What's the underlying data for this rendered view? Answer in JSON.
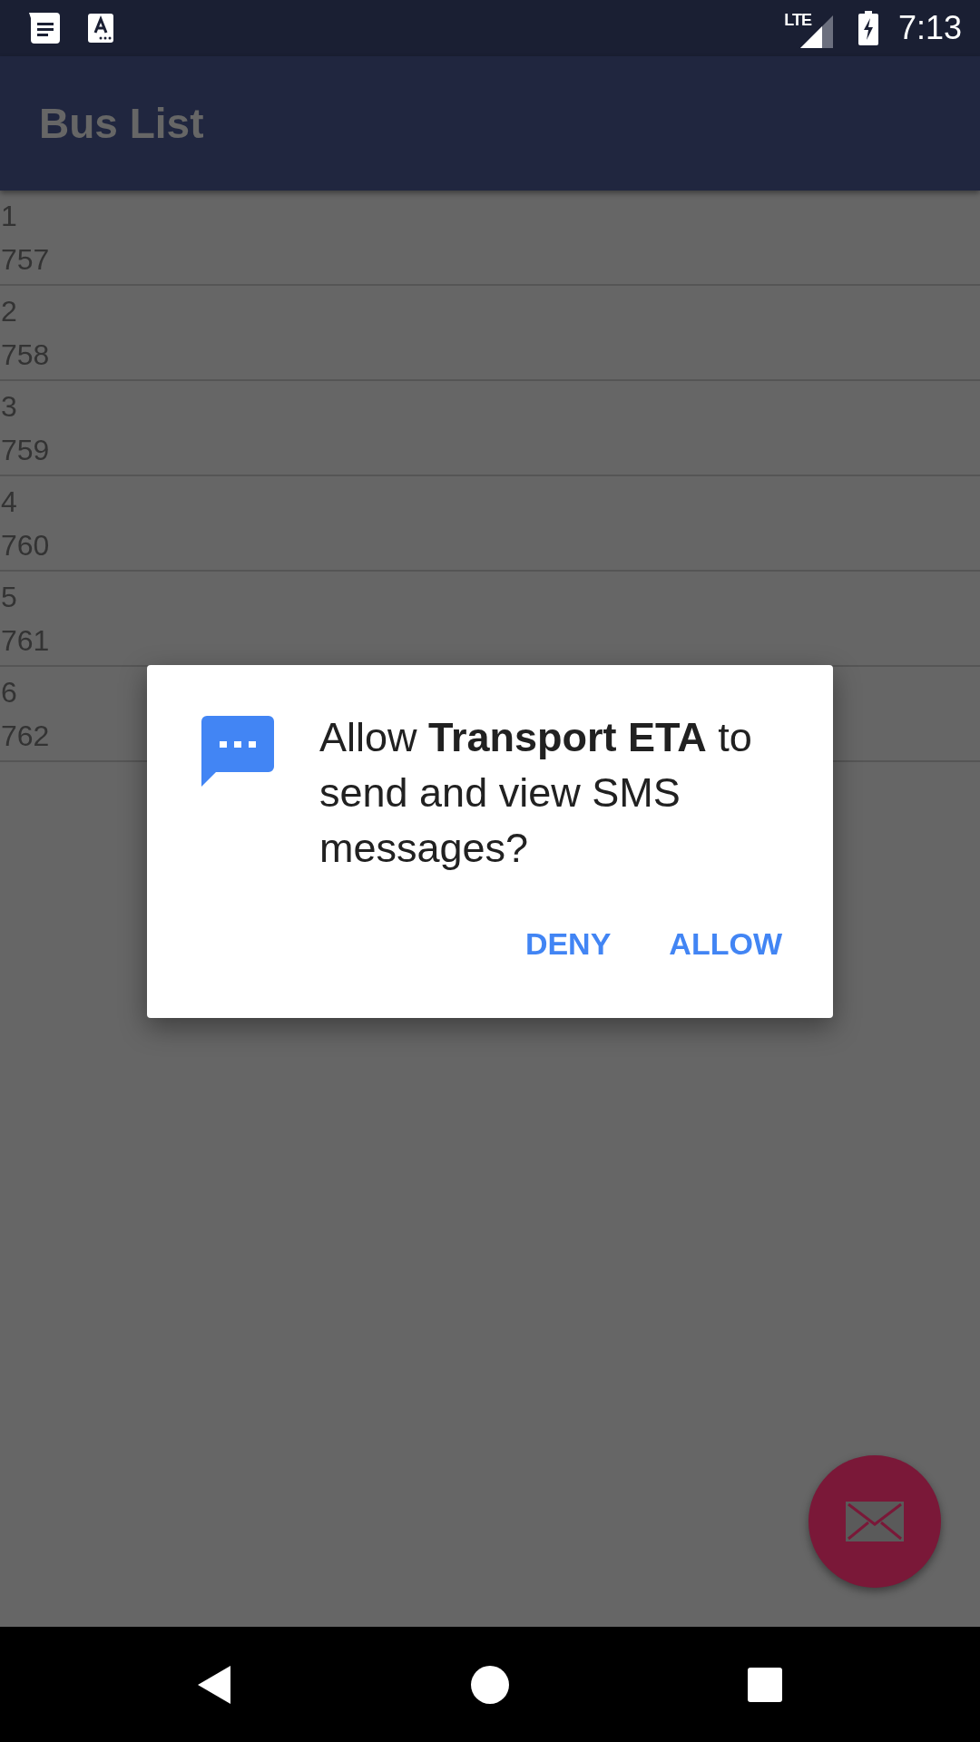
{
  "status_bar": {
    "time": "7:13",
    "network": "LTE"
  },
  "app_bar": {
    "title": "Bus List"
  },
  "buses": [
    {
      "index": "1",
      "number": "757"
    },
    {
      "index": "2",
      "number": "758"
    },
    {
      "index": "3",
      "number": "759"
    },
    {
      "index": "4",
      "number": "760"
    },
    {
      "index": "5",
      "number": "761"
    },
    {
      "index": "6",
      "number": "762"
    }
  ],
  "dialog": {
    "message": "Allow **Transport ETA** to send and view SMS messages?",
    "buttons": [
      "DENY",
      "ALLOW"
    ]
  }
}
